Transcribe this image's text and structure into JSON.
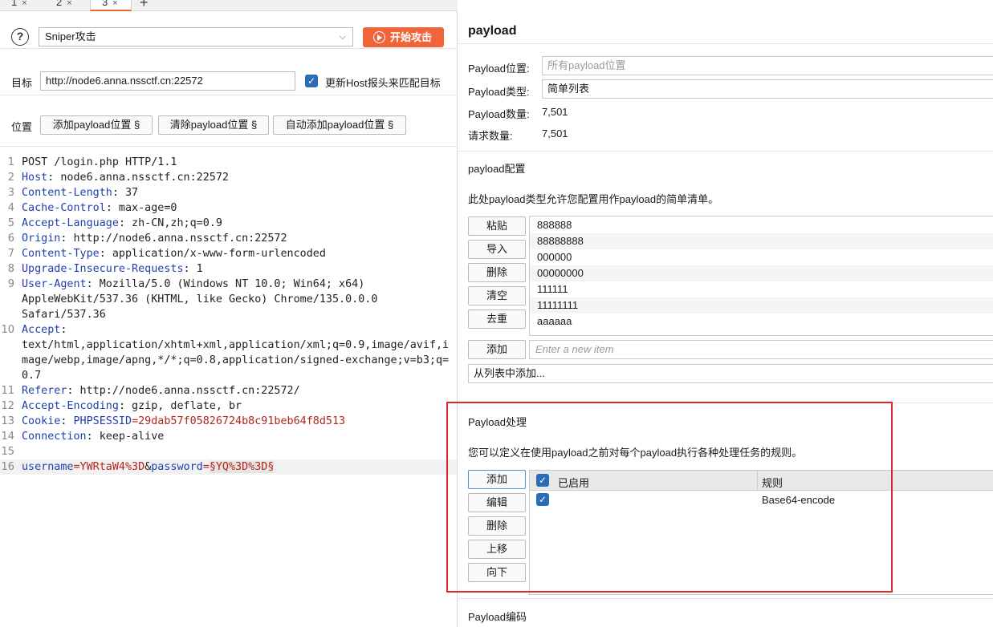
{
  "tabs": [
    {
      "label": "1",
      "close": "×"
    },
    {
      "label": "2",
      "close": "×"
    },
    {
      "label": "3",
      "close": "×"
    }
  ],
  "tab_add": "+",
  "left": {
    "attack_mode": "Sniper攻击",
    "start_attack": "开始攻击",
    "target_label": "目标",
    "target_value": "http://node6.anna.nssctf.cn:22572",
    "update_host_label": "更新Host报头来匹配目标",
    "update_host_checked": true,
    "positions_label": "位置",
    "add_payload_pos": "添加payload位置 §",
    "clear_payload_pos": "清除payload位置 §",
    "auto_payload_pos": "自动添加payload位置 §"
  },
  "request": [
    {
      "n": "1",
      "parts": [
        {
          "t": "POST /login.php HTTP/1.1",
          "c": "plain"
        }
      ]
    },
    {
      "n": "2",
      "parts": [
        {
          "t": "Host",
          "c": "key"
        },
        {
          "t": ": node6.anna.nssctf.cn:22572",
          "c": "plain"
        }
      ]
    },
    {
      "n": "3",
      "parts": [
        {
          "t": "Content-Length",
          "c": "key"
        },
        {
          "t": ": 37",
          "c": "plain"
        }
      ]
    },
    {
      "n": "4",
      "parts": [
        {
          "t": "Cache-Control",
          "c": "key"
        },
        {
          "t": ": max-age=0",
          "c": "plain"
        }
      ]
    },
    {
      "n": "5",
      "parts": [
        {
          "t": "Accept-Language",
          "c": "key"
        },
        {
          "t": ": zh-CN,zh;q=0.9",
          "c": "plain"
        }
      ]
    },
    {
      "n": "6",
      "parts": [
        {
          "t": "Origin",
          "c": "key"
        },
        {
          "t": ": http://node6.anna.nssctf.cn:22572",
          "c": "plain"
        }
      ]
    },
    {
      "n": "7",
      "parts": [
        {
          "t": "Content-Type",
          "c": "key"
        },
        {
          "t": ": application/x-www-form-urlencoded",
          "c": "plain"
        }
      ]
    },
    {
      "n": "8",
      "parts": [
        {
          "t": "Upgrade-Insecure-Requests",
          "c": "key"
        },
        {
          "t": ": 1",
          "c": "plain"
        }
      ]
    },
    {
      "n": "9",
      "parts": [
        {
          "t": "User-Agent",
          "c": "key"
        },
        {
          "t": ": Mozilla/5.0 (Windows NT 10.0; Win64; x64)",
          "c": "plain"
        }
      ]
    },
    {
      "n": "",
      "parts": [
        {
          "t": "AppleWebKit/537.36 (KHTML, like Gecko) Chrome/135.0.0.0",
          "c": "plain"
        }
      ]
    },
    {
      "n": "",
      "parts": [
        {
          "t": "Safari/537.36",
          "c": "plain"
        }
      ]
    },
    {
      "n": "10",
      "parts": [
        {
          "t": "Accept",
          "c": "key"
        },
        {
          "t": ":",
          "c": "plain"
        }
      ]
    },
    {
      "n": "",
      "parts": [
        {
          "t": "text/html,application/xhtml+xml,application/xml;q=0.9,image/avif,i",
          "c": "plain"
        }
      ]
    },
    {
      "n": "",
      "parts": [
        {
          "t": "mage/webp,image/apng,*/*;q=0.8,application/signed-exchange;v=b3;q=",
          "c": "plain"
        }
      ]
    },
    {
      "n": "",
      "parts": [
        {
          "t": "0.7",
          "c": "plain"
        }
      ]
    },
    {
      "n": "11",
      "parts": [
        {
          "t": "Referer",
          "c": "key"
        },
        {
          "t": ": http://node6.anna.nssctf.cn:22572/",
          "c": "plain"
        }
      ]
    },
    {
      "n": "12",
      "parts": [
        {
          "t": "Accept-Encoding",
          "c": "key"
        },
        {
          "t": ": gzip, deflate, br",
          "c": "plain"
        }
      ]
    },
    {
      "n": "13",
      "parts": [
        {
          "t": "Cookie",
          "c": "key"
        },
        {
          "t": ": ",
          "c": "plain"
        },
        {
          "t": "PHPSESSID",
          "c": "key"
        },
        {
          "t": "=29dab57f05826724b8c91beb64f8d513",
          "c": "val"
        }
      ]
    },
    {
      "n": "14",
      "parts": [
        {
          "t": "Connection",
          "c": "key"
        },
        {
          "t": ": keep-alive",
          "c": "plain"
        }
      ]
    },
    {
      "n": "15",
      "parts": []
    },
    {
      "n": "16",
      "highlight": true,
      "parts": [
        {
          "t": "username",
          "c": "key"
        },
        {
          "t": "=YWRtaW4%3D",
          "c": "val"
        },
        {
          "t": "&",
          "c": "plain"
        },
        {
          "t": "password",
          "c": "key"
        },
        {
          "t": "=",
          "c": "val"
        },
        {
          "t": "§YQ%3D%3D§",
          "c": "marker"
        }
      ]
    }
  ],
  "right": {
    "title": "payload",
    "position_label": "Payload位置:",
    "position_placeholder": "所有payload位置",
    "type_label": "Payload类型:",
    "type_value": "简单列表",
    "count_label": "Payload数量:",
    "count_value": "7,501",
    "requests_label": "请求数量:",
    "requests_value": "7,501",
    "config_title": "payload配置",
    "config_desc": "此处payload类型允许您配置用作payload的简单清单。",
    "list_buttons": [
      "粘贴",
      "导入",
      "删除",
      "清空",
      "去重"
    ],
    "list_items": [
      "888888",
      "88888888",
      "000000",
      "00000000",
      "111111",
      "11111111",
      "aaaaaa"
    ],
    "add_button": "添加",
    "new_item_placeholder": "Enter a new item",
    "add_from_list": "从列表中添加...",
    "processing_title": "Payload处理",
    "processing_desc": "您可以定义在使用payload之前对每个payload执行各种处理任务的规则。",
    "rule_buttons": [
      "添加",
      "编辑",
      "删除",
      "上移",
      "向下"
    ],
    "rules_header": {
      "enabled": "已启用",
      "rule": "规则"
    },
    "rules": [
      {
        "enabled": true,
        "rule": "Base64-encode"
      }
    ],
    "encoding_title": "Payload编码"
  },
  "colors": {
    "accent": "#f0643a",
    "checkbox": "#2b6cb7",
    "highlight_box": "#e0262a",
    "header_key": "#1f3fad",
    "value": "#b0261a"
  }
}
